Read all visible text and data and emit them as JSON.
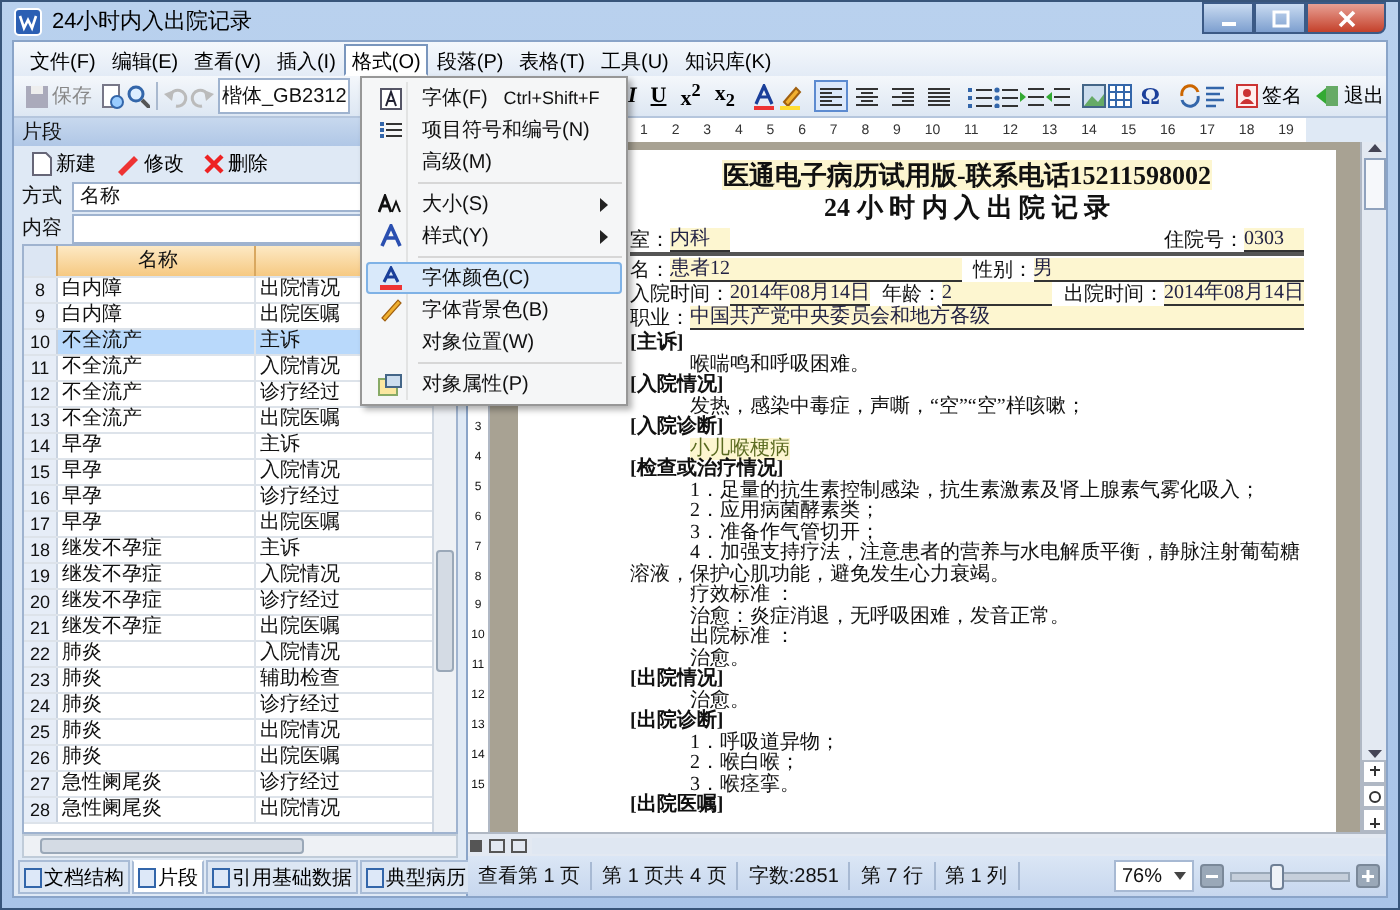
{
  "window": {
    "title": "24小时内入出院记录"
  },
  "menubar": [
    {
      "label": "文件(F)",
      "selected": false
    },
    {
      "label": "编辑(E)",
      "selected": false
    },
    {
      "label": "查看(V)",
      "selected": false
    },
    {
      "label": "插入(I)",
      "selected": false
    },
    {
      "label": "格式(O)",
      "selected": true
    },
    {
      "label": "段落(P)",
      "selected": false
    },
    {
      "label": "表格(T)",
      "selected": false
    },
    {
      "label": "工具(U)",
      "selected": false
    },
    {
      "label": "知识库(K)",
      "selected": false
    }
  ],
  "toolbar": {
    "save": "保存",
    "font_name": "楷体_GB2312",
    "format_buttons": [
      {
        "kind": "italic",
        "label": "I"
      },
      {
        "kind": "underline",
        "label": "U"
      },
      {
        "kind": "script",
        "label": "x$^{2}$"
      },
      {
        "kind": "script",
        "label": "x$_{2}$"
      }
    ],
    "align_buttons": [
      {
        "kind": "left",
        "selected": true
      },
      {
        "kind": "center",
        "selected": false
      },
      {
        "kind": "right",
        "selected": false
      },
      {
        "kind": "justify",
        "selected": false
      }
    ],
    "symbol": "Ω",
    "sign": "签名",
    "exit": "退出"
  },
  "format_menu": [
    {
      "kind": "item",
      "label": "字体(F)",
      "shortcut": "Ctrl+Shift+F",
      "submenu": false,
      "selected": false
    },
    {
      "kind": "item",
      "label": "项目符号和编号(N)",
      "submenu": false,
      "selected": false
    },
    {
      "kind": "item",
      "label": "高级(M)",
      "submenu": false,
      "selected": false
    },
    {
      "kind": "separator"
    },
    {
      "kind": "item",
      "label": "大小(S)",
      "submenu": true,
      "selected": false
    },
    {
      "kind": "item",
      "label": "样式(Y)",
      "submenu": true,
      "selected": false
    },
    {
      "kind": "separator"
    },
    {
      "kind": "item",
      "label": "字体颜色(C)",
      "submenu": false,
      "selected": true
    },
    {
      "kind": "item",
      "label": "字体背景色(B)",
      "submenu": false,
      "selected": false
    },
    {
      "kind": "item",
      "label": "对象位置(W)",
      "submenu": false,
      "selected": false
    },
    {
      "kind": "separator"
    },
    {
      "kind": "item",
      "label": "对象属性(P)",
      "submenu": false,
      "selected": false
    }
  ],
  "snippet_panel": {
    "title": "片段",
    "buttons": [
      "新建",
      "修改",
      "删除"
    ],
    "mode_label": "方式",
    "mode_value": "名称",
    "content_label": "内容",
    "columns": [
      "名称"
    ],
    "rows": [
      {
        "num": "8",
        "name": "白内障",
        "column_2": "出院情况",
        "selected": false
      },
      {
        "num": "9",
        "name": "白内障",
        "column_2": "出院医嘱",
        "selected": false
      },
      {
        "num": "10",
        "name": "不全流产",
        "column_2": "主诉",
        "selected": true
      },
      {
        "num": "11",
        "name": "不全流产",
        "column_2": "入院情况",
        "selected": false
      },
      {
        "num": "12",
        "name": "不全流产",
        "column_2": "诊疗经过",
        "selected": false
      },
      {
        "num": "13",
        "name": "不全流产",
        "column_2": "出院医嘱",
        "selected": false
      },
      {
        "num": "14",
        "name": "早孕",
        "column_2": "主诉",
        "selected": false
      },
      {
        "num": "15",
        "name": "早孕",
        "column_2": "入院情况",
        "selected": false
      },
      {
        "num": "16",
        "name": "早孕",
        "column_2": "诊疗经过",
        "selected": false
      },
      {
        "num": "17",
        "name": "早孕",
        "column_2": "出院医嘱",
        "selected": false
      },
      {
        "num": "18",
        "name": "继发不孕症",
        "column_2": "主诉",
        "selected": false
      },
      {
        "num": "19",
        "name": "继发不孕症",
        "column_2": "入院情况",
        "selected": false
      },
      {
        "num": "20",
        "name": "继发不孕症",
        "column_2": "诊疗经过",
        "selected": false
      },
      {
        "num": "21",
        "name": "继发不孕症",
        "column_2": "出院医嘱",
        "selected": false
      },
      {
        "num": "22",
        "name": "肺炎",
        "column_2": "入院情况",
        "selected": false
      },
      {
        "num": "23",
        "name": "肺炎",
        "column_2": "辅助检查",
        "selected": false
      },
      {
        "num": "24",
        "name": "肺炎",
        "column_2": "诊疗经过",
        "selected": false
      },
      {
        "num": "25",
        "name": "肺炎",
        "column_2": "出院情况",
        "selected": false
      },
      {
        "num": "26",
        "name": "肺炎",
        "column_2": "出院医嘱",
        "selected": false
      },
      {
        "num": "27",
        "name": "急性阑尾炎",
        "column_2": "诊疗经过",
        "selected": false
      },
      {
        "num": "28",
        "name": "急性阑尾炎",
        "column_2": "出院情况",
        "selected": false
      }
    ]
  },
  "bottom_tabs": [
    {
      "label": "文档结构",
      "selected": false
    },
    {
      "label": "片段",
      "selected": true
    },
    {
      "label": "引用基础数据",
      "selected": false
    },
    {
      "label": "典型病历",
      "selected": false
    }
  ],
  "ruler": [
    "1",
    "2",
    "3",
    "4",
    "5",
    "6",
    "7",
    "8",
    "9",
    "10",
    "11",
    "12",
    "13",
    "14",
    "15",
    "16",
    "17",
    "18",
    "19"
  ],
  "vertical_ruler": [
    "3",
    "4",
    "5",
    "6",
    "7",
    "8",
    "9",
    "10",
    "11",
    "12",
    "13",
    "14",
    "15"
  ],
  "record": {
    "banner": "医通电子病历试用版-联系电话15211598002",
    "title": "24 小 时 内 入 出 院 记 录",
    "field_rows": [
      [
        {
          "label": "室：",
          "value": "内科"
        },
        {
          "label": "住院号：",
          "value": "0303"
        }
      ],
      [
        {
          "label": "名：",
          "value": "患者12"
        },
        {
          "label": "性别：",
          "value": "男"
        }
      ],
      [
        {
          "label": "入院时间：",
          "value": "2014年08月14日"
        },
        {
          "label": "年龄：",
          "value": "2"
        },
        {
          "label": "出院时间：",
          "value": "2014年08月14日"
        }
      ],
      [
        {
          "label": "职业：",
          "value": "中国共产党中央委员会和地方各级"
        }
      ]
    ],
    "sections": [
      {
        "heading": "[主诉]",
        "lines": [
          {
            "text": "喉喘鸣和呼吸困难。",
            "highlighted": false
          }
        ]
      },
      {
        "heading": "[入院情况]",
        "lines": [
          {
            "text": "发热，感染中毒症，声嘶，“空”“空”样咳嗽；",
            "highlighted": false
          }
        ]
      },
      {
        "heading": "[入院诊断]",
        "lines": [
          {
            "text": "小儿喉梗病",
            "highlighted": true
          }
        ]
      },
      {
        "heading": "[检查或治疗情况]",
        "lines": [
          {
            "text": "1．足量的抗生素控制感染，抗生素激素及肾上腺素气雾化吸入；",
            "highlighted": false
          },
          {
            "text": "2．应用病菌酵素类；",
            "highlighted": false
          },
          {
            "text": "3．准备作气管切开；",
            "highlighted": false
          },
          {
            "text": "4．加强支持疗法，注意患者的营养与水电解质平衡，静脉注射葡萄糖溶液，保护心肌功能，避免发生心力衰竭。",
            "highlighted": false
          },
          {
            "text": "疗效标准 ：",
            "highlighted": false
          },
          {
            "text": "治愈：炎症消退，无呼吸困难，发音正常。",
            "highlighted": false
          },
          {
            "text": "出院标准 ：",
            "highlighted": false
          },
          {
            "text": "治愈。",
            "highlighted": false
          }
        ]
      },
      {
        "heading": "[出院情况]",
        "lines": [
          {
            "text": "治愈。",
            "highlighted": false
          }
        ]
      },
      {
        "heading": "[出院诊断]",
        "lines": [
          {
            "text": "1．呼吸道异物；",
            "highlighted": false
          },
          {
            "text": "2．喉白喉；",
            "highlighted": false
          },
          {
            "text": "3．喉痉挛。",
            "highlighted": false
          }
        ]
      },
      {
        "heading": "[出院医嘱]"
      }
    ]
  },
  "status_bar": {
    "items": [
      "查看第 1 页",
      "第 1 页共 4 页",
      "字数:2851",
      "第 7 行",
      "第 1 列"
    ],
    "zoom": "76%",
    "zoom_level": {
      "level": 0.38
    }
  }
}
